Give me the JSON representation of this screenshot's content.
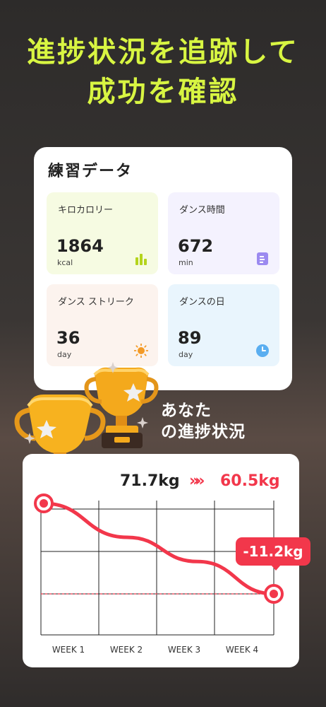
{
  "headline": {
    "line1": "進捗状況を追跡して",
    "line2": "成功を確認",
    "color": "#d8f542"
  },
  "practice_card": {
    "title": "練習データ",
    "tiles": [
      {
        "label": "キロカロリー",
        "value": "1864",
        "unit": "kcal",
        "icon": "bar-chart-icon",
        "color": "#b4d41c"
      },
      {
        "label": "ダンス時間",
        "value": "672",
        "unit": "min",
        "icon": "document-icon",
        "color": "#9b8af0"
      },
      {
        "label": "ダンス ストリーク",
        "value": "36",
        "unit": "day",
        "icon": "sun-icon",
        "color": "#f39a26"
      },
      {
        "label": "ダンスの日",
        "value": "89",
        "unit": "day",
        "icon": "clock-icon",
        "color": "#5aaef0"
      }
    ]
  },
  "progress": {
    "title_line1": "あなた",
    "title_line2": "の進捗状況",
    "from_weight": "71.7kg",
    "arrow": "»»",
    "to_weight": "60.5kg",
    "change": "-11.2kg",
    "accent": "#f2374b",
    "chart_data": {
      "type": "line",
      "categories": [
        "WEEK 1",
        "WEEK 2",
        "WEEK 3",
        "WEEK 4"
      ],
      "series": [
        {
          "values": [
            71.7,
            67.5,
            64.5,
            60.5
          ]
        }
      ]
    }
  }
}
